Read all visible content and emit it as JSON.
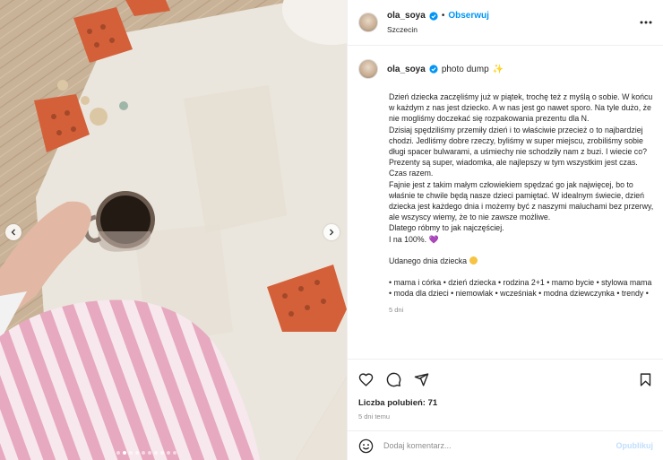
{
  "colors": {
    "link_blue": "#0095f6",
    "muted_text": "#8e8e8e",
    "publish_disabled": "#c0dffd",
    "verified_badge": "#0095f6"
  },
  "header": {
    "username": "ola_soya",
    "separator": "•",
    "follow_label": "Obserwuj",
    "location": "Szczecin",
    "more_icon": "more-horizontal-icon"
  },
  "caption": {
    "username": "ola_soya",
    "title": "photo dump",
    "title_emoji": "✨",
    "paragraphs": [
      "Dzień dziecka zaczęliśmy już w piątek, trochę też z myślą o sobie. W końcu w każdym z nas jest dziecko. A w nas jest go nawet sporo. Na tyle dużo, że nie mogliśmy doczekać się rozpakowania prezentu dla N.",
      "Dzisiaj spędziliśmy przemiły dzień i to właściwie przecież o to najbardziej chodzi. Jedliśmy dobre rzeczy, byliśmy w super miejscu, zrobiliśmy sobie długi spacer bulwarami, a uśmiechy nie schodziły nam z buzi. I wiecie co? Prezenty są super, wiadomka, ale najlepszy w tym wszystkim jest czas. Czas razem.",
      "Fajnie jest z takim małym człowiekiem spędzać go jak najwięcej, bo to właśnie te chwile będą nasze dzieci pamiętać. W idealnym świecie, dzień dziecka jest każdego dnia i możemy być z naszymi maluchami bez przerwy, ale wszyscy wiemy, że to nie zawsze możliwe.",
      "Dlatego róbmy to jak najczęściej.",
      "I na 100%."
    ],
    "heart_emoji": "💜",
    "closing": "Udanego dnia dziecka",
    "hashtags": "• mama i córka • dzień dziecka • rodzina 2+1 • mamo bycie • stylowa mama • moda dla dzieci • niemowlak • wcześniak • modna dziewczynka • trendy •",
    "time_ago": "5 dni"
  },
  "actions": {
    "like_icon": "heart-icon",
    "comment_icon": "comment-icon",
    "share_icon": "send-icon",
    "save_icon": "bookmark-icon",
    "likes_label": "Liczba polubień: 71",
    "posted": "5 dni temu"
  },
  "comment": {
    "placeholder": "Dodaj komentarz...",
    "publish_label": "Opublikuj",
    "emoji_icon": "smiley-icon"
  },
  "carousel": {
    "total_slides": 10,
    "active_index": 1
  }
}
